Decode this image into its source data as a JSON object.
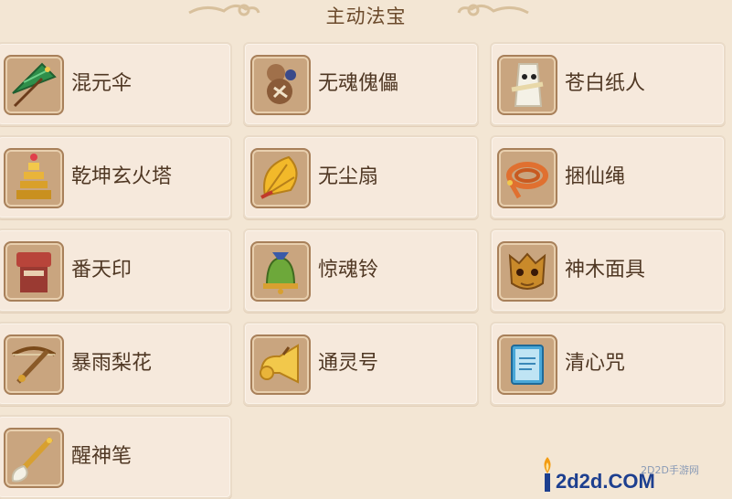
{
  "header": {
    "title": "主动法宝"
  },
  "items": [
    {
      "label": "混元伞",
      "icon": "umbrella-icon"
    },
    {
      "label": "无魂傀儡",
      "icon": "puppet-icon"
    },
    {
      "label": "苍白纸人",
      "icon": "paper-doll-icon"
    },
    {
      "label": "乾坤玄火塔",
      "icon": "pagoda-icon"
    },
    {
      "label": "无尘扇",
      "icon": "fan-icon"
    },
    {
      "label": "捆仙绳",
      "icon": "rope-icon"
    },
    {
      "label": "番天印",
      "icon": "seal-icon"
    },
    {
      "label": "惊魂铃",
      "icon": "bell-icon"
    },
    {
      "label": "神木面具",
      "icon": "mask-icon"
    },
    {
      "label": "暴雨梨花",
      "icon": "crossbow-icon"
    },
    {
      "label": "通灵号",
      "icon": "horn-icon"
    },
    {
      "label": "清心咒",
      "icon": "scroll-book-icon"
    },
    {
      "label": "醒神笔",
      "icon": "brush-icon"
    }
  ],
  "watermark": {
    "site_name": "2D2D手游网",
    "domain": "2d2d.COM"
  }
}
